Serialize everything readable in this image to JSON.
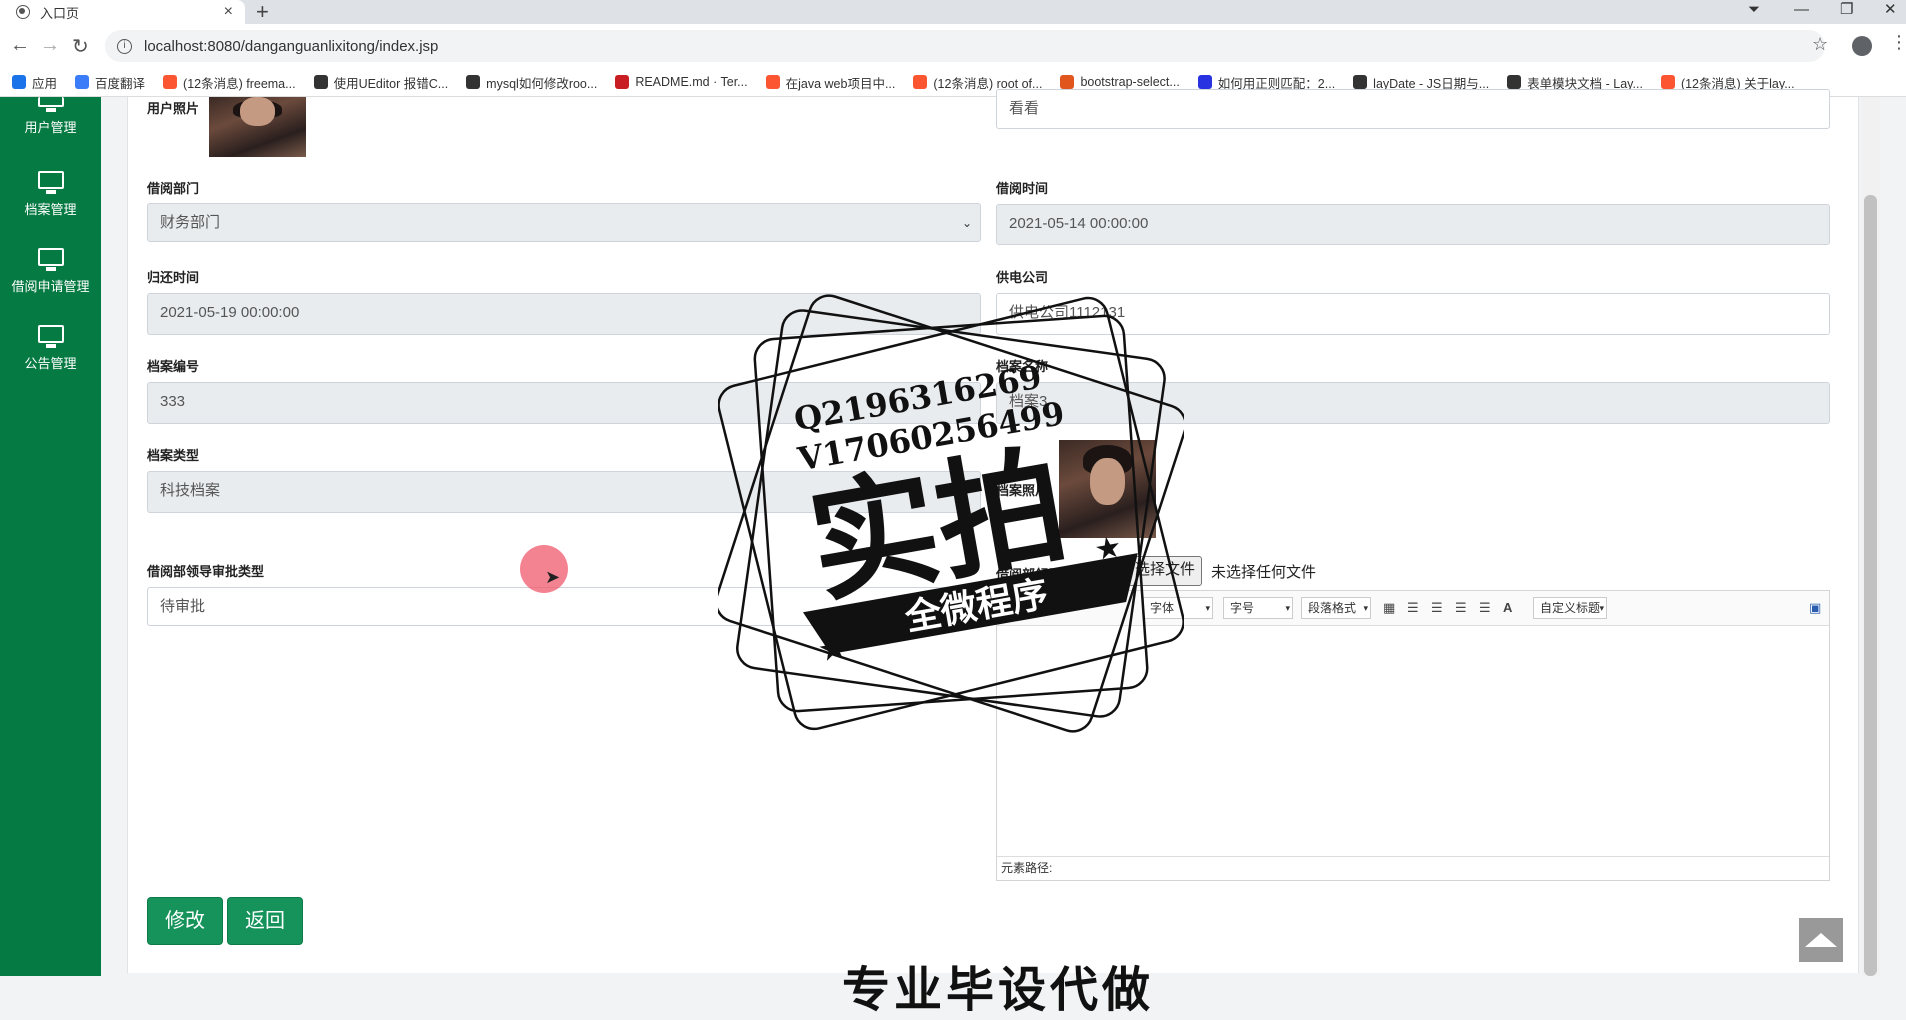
{
  "browser": {
    "tab_title": "入口页",
    "url": "localhost:8080/danganguanlixitong/index.jsp",
    "bookmarks": [
      {
        "label": "应用",
        "color": "#1a73e8"
      },
      {
        "label": "百度翻译",
        "color": "#3b7df8"
      },
      {
        "label": "(12条消息) freema...",
        "color": "#fc5531"
      },
      {
        "label": "使用UEditor 报错C...",
        "color": "#333333"
      },
      {
        "label": "mysql如何修改roo...",
        "color": "#333333"
      },
      {
        "label": "README.md · Ter...",
        "color": "#c71d23"
      },
      {
        "label": "在java web项目中...",
        "color": "#fc5531"
      },
      {
        "label": "(12条消息) root of...",
        "color": "#fc5531"
      },
      {
        "label": "bootstrap-select...",
        "color": "#e0561c"
      },
      {
        "label": "如何用正则匹配：2...",
        "color": "#2932e1"
      },
      {
        "label": "layDate - JS日期与...",
        "color": "#333333"
      },
      {
        "label": "表单模块文档 - Lay...",
        "color": "#333333"
      },
      {
        "label": "(12条消息) 关于lay...",
        "color": "#fc5531"
      }
    ]
  },
  "sidebar": {
    "items": [
      {
        "label": "用户管理"
      },
      {
        "label": "档案管理"
      },
      {
        "label": "借阅申请管理"
      },
      {
        "label": "公告管理"
      }
    ],
    "bg_color": "#067a43"
  },
  "form": {
    "user_photo_label": "用户照片",
    "top_right_value": "看看",
    "dept_label": "借阅部门",
    "dept_value": "财务部门",
    "borrow_time_label": "借阅时间",
    "borrow_time_value": "2021-05-14 00:00:00",
    "return_time_label": "归还时间",
    "return_time_value": "2021-05-19 00:00:00",
    "company_label": "供电公司",
    "company_value": "供电公司1112131",
    "archive_no_label": "档案编号",
    "archive_no_value": "333",
    "archive_name_label": "档案名称",
    "archive_name_value": "档案3",
    "archive_type_label": "档案类型",
    "archive_type_value": "科技档案",
    "archive_photo_label": "档案照片",
    "approval_type_label": "借阅部领导审批类型",
    "approval_type_value": "待审批",
    "approval_opinion_label": "借阅部领导审批意见",
    "file_button": "选择文件",
    "file_status": "未选择任何文件"
  },
  "editor": {
    "font_family": "字体",
    "font_size": "字号",
    "paragraph": "段落格式",
    "custom_title": "自定义标题",
    "path_label": "元素路径:"
  },
  "actions": {
    "modify": "修改",
    "back": "返回"
  },
  "watermark": {
    "line1": "Q2196316269",
    "line2": "V17060256499",
    "big": "实拍",
    "ribbon": "全微程序",
    "bottom": "专业毕设代做"
  }
}
